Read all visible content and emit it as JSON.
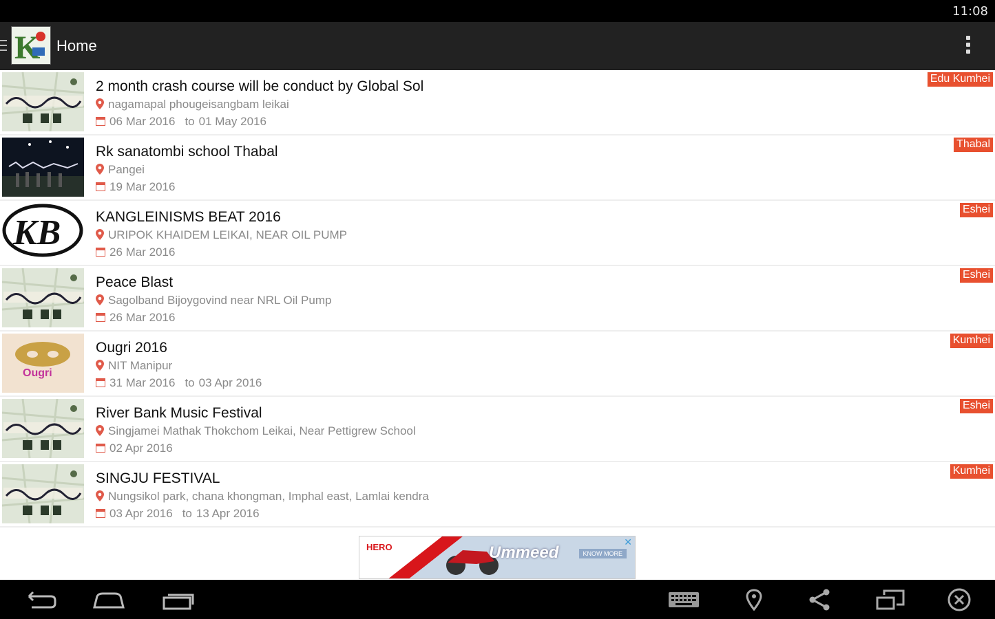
{
  "status_bar": {
    "time": "11:08"
  },
  "action_bar": {
    "title": "Home"
  },
  "events": [
    {
      "title": "2 month crash course will be conduct by Global Sol",
      "location": "nagamapal phougeisangbam leikai",
      "start_date": "06 Mar 2016",
      "to_label": "to",
      "end_date": "01 May 2016",
      "tag": "Edu Kumhei",
      "thumb": "map"
    },
    {
      "title": "Rk sanatombi school Thabal",
      "location": "Pangei",
      "start_date": "19 Mar 2016",
      "to_label": "",
      "end_date": "",
      "tag": "Thabal",
      "thumb": "night"
    },
    {
      "title": "KANGLEINISMS BEAT 2016",
      "location": "URIPOK KHAIDEM LEIKAI, NEAR OIL PUMP",
      "start_date": "26 Mar 2016",
      "to_label": "",
      "end_date": "",
      "tag": "Eshei",
      "thumb": "kb"
    },
    {
      "title": "Peace Blast",
      "location": "Sagolband Bijoygovind near NRL Oil Pump",
      "start_date": "26 Mar 2016",
      "to_label": "",
      "end_date": "",
      "tag": "Eshei",
      "thumb": "map"
    },
    {
      "title": "Ougri 2016",
      "location": "NIT Manipur",
      "start_date": "31 Mar 2016",
      "to_label": "to",
      "end_date": "03 Apr 2016",
      "tag": "Kumhei",
      "thumb": "ougri"
    },
    {
      "title": "River Bank Music Festival",
      "location": "Singjamei Mathak Thokchom Leikai, Near Pettigrew School",
      "start_date": "02 Apr 2016",
      "to_label": "",
      "end_date": "",
      "tag": "Eshei",
      "thumb": "map"
    },
    {
      "title": "SINGJU FESTIVAL",
      "location": "Nungsikol park, chana khongman, Imphal east, Lamlai kendra",
      "start_date": "03 Apr 2016",
      "to_label": "to",
      "end_date": "13 Apr 2016",
      "tag": "Kumhei",
      "thumb": "map"
    }
  ],
  "ad": {
    "brand": "HERO",
    "headline": "Ummeed",
    "cta": "KNOW MORE"
  },
  "colors": {
    "tag_bg": "#e8502f",
    "action_bar": "#222222",
    "status_bar": "#000000",
    "pin": "#e05a4a"
  },
  "nav_icons": [
    "back-icon",
    "home-icon",
    "recent-apps-icon",
    "keyboard-icon",
    "location-icon",
    "share-icon",
    "rotate-screen-icon",
    "close-icon"
  ]
}
